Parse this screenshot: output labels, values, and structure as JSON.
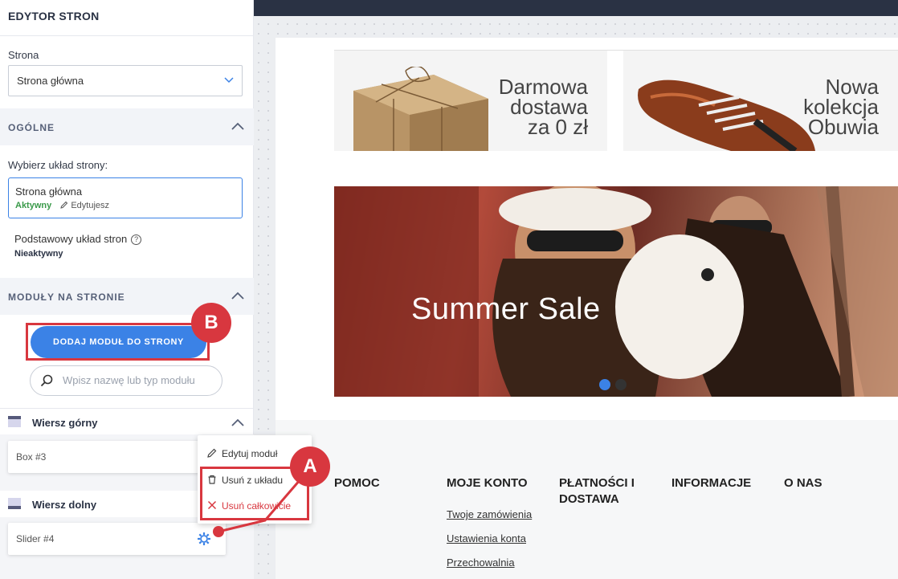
{
  "sidebar": {
    "title": "EDYTOR STRON",
    "page_label": "Strona",
    "page_select_value": "Strona główna",
    "section_general": "OGÓLNE",
    "choose_layout_label": "Wybierz układ strony:",
    "layout_active": {
      "name": "Strona główna",
      "status": "Aktywny",
      "edit": "Edytujesz"
    },
    "layout_basic": {
      "name": "Podstawowy układ stron",
      "status": "Nieaktywny",
      "help": "?"
    },
    "section_modules": "MODUŁY NA STRONIE",
    "add_module_button": "DODAJ MODUŁ DO STRONY",
    "search_placeholder": "Wpisz nazwę lub typ modułu",
    "rows": [
      {
        "title": "Wiersz górny",
        "modules": [
          "Box #3"
        ]
      },
      {
        "title": "Wiersz dolny",
        "modules": [
          "Slider #4"
        ]
      }
    ],
    "context_menu": {
      "edit": "Edytuj moduł",
      "remove_layout": "Usuń z układu",
      "remove_all": "Usuń całkowicie"
    }
  },
  "badges": {
    "a": "A",
    "b": "B"
  },
  "preview": {
    "banner1": [
      "Darmowa",
      "dostawa",
      "za 0 zł"
    ],
    "banner2": [
      "Nowa",
      "kolekcja",
      "Obuwia"
    ],
    "hero_text": "Summer Sale",
    "footer_cols": [
      "POMOC",
      "MOJE KONTO",
      "PŁATNOŚCI I DOSTAWA",
      "INFORMACJE",
      "O NAS"
    ],
    "footer_links": [
      "Twoje zamówienia",
      "Ustawienia konta",
      "Przechowalnia"
    ]
  },
  "colors": {
    "accent": "#3b82e6",
    "highlight": "#d8373f",
    "header": "#2a3244",
    "active_green": "#3a9a4a"
  }
}
